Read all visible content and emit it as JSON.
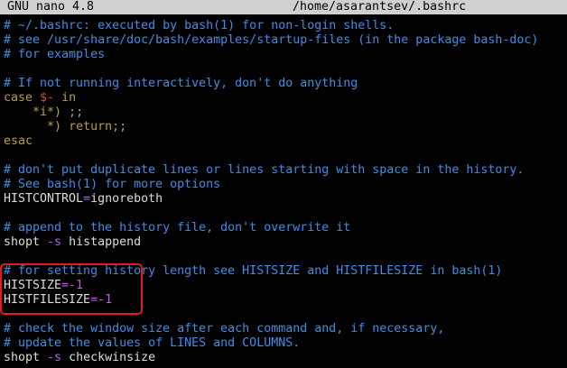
{
  "window": {
    "app_title": "GNU nano 4.8",
    "file_path": "/home/asarantsev/.bashrc"
  },
  "lines": [
    {
      "comment": "# ~/.bashrc: executed by bash(1) for non-login shells."
    },
    {
      "comment": "# see /usr/share/doc/bash/examples/startup-files (in the package bash-doc)"
    },
    {
      "comment": "# for examples"
    },
    {},
    {
      "comment": "# If not running interactively, don't do anything"
    },
    {
      "kw1": "case",
      "var": "$-",
      "kw2": "in"
    },
    {
      "indent": "    ",
      "pattern": "*i*)",
      "rest": " ;;"
    },
    {
      "indent": "      ",
      "pattern": "*)",
      "rest": " return;;"
    },
    {
      "kw1": "esac"
    },
    {},
    {
      "comment": "# don't put duplicate lines or lines starting with space in the history."
    },
    {
      "comment": "# See bash(1) for more options"
    },
    {
      "name": "HISTCONTROL",
      "op": "=",
      "value": "ignoreboth"
    },
    {},
    {
      "comment": "# append to the history file, don't overwrite it"
    },
    {
      "cmd": "shopt",
      "flag": "-s",
      "arg": "histappend"
    },
    {},
    {
      "comment": "# for setting history length see HISTSIZE and HISTFILESIZE in bash(1)"
    },
    {
      "name": "HISTSIZE",
      "op": "=-1"
    },
    {
      "name": "HISTFILESIZE",
      "op": "=-1"
    },
    {},
    {
      "comment": "# check the window size after each command and, if necessary,"
    },
    {
      "comment": "# update the values of LINES and COLUMNS."
    },
    {
      "cmd": "shopt",
      "flag": "-s",
      "arg": "checkwinsize"
    }
  ],
  "colors": {
    "comment": "#3b8eea",
    "keyword": "#b5a036",
    "highlight_box": "#e51a1a"
  }
}
